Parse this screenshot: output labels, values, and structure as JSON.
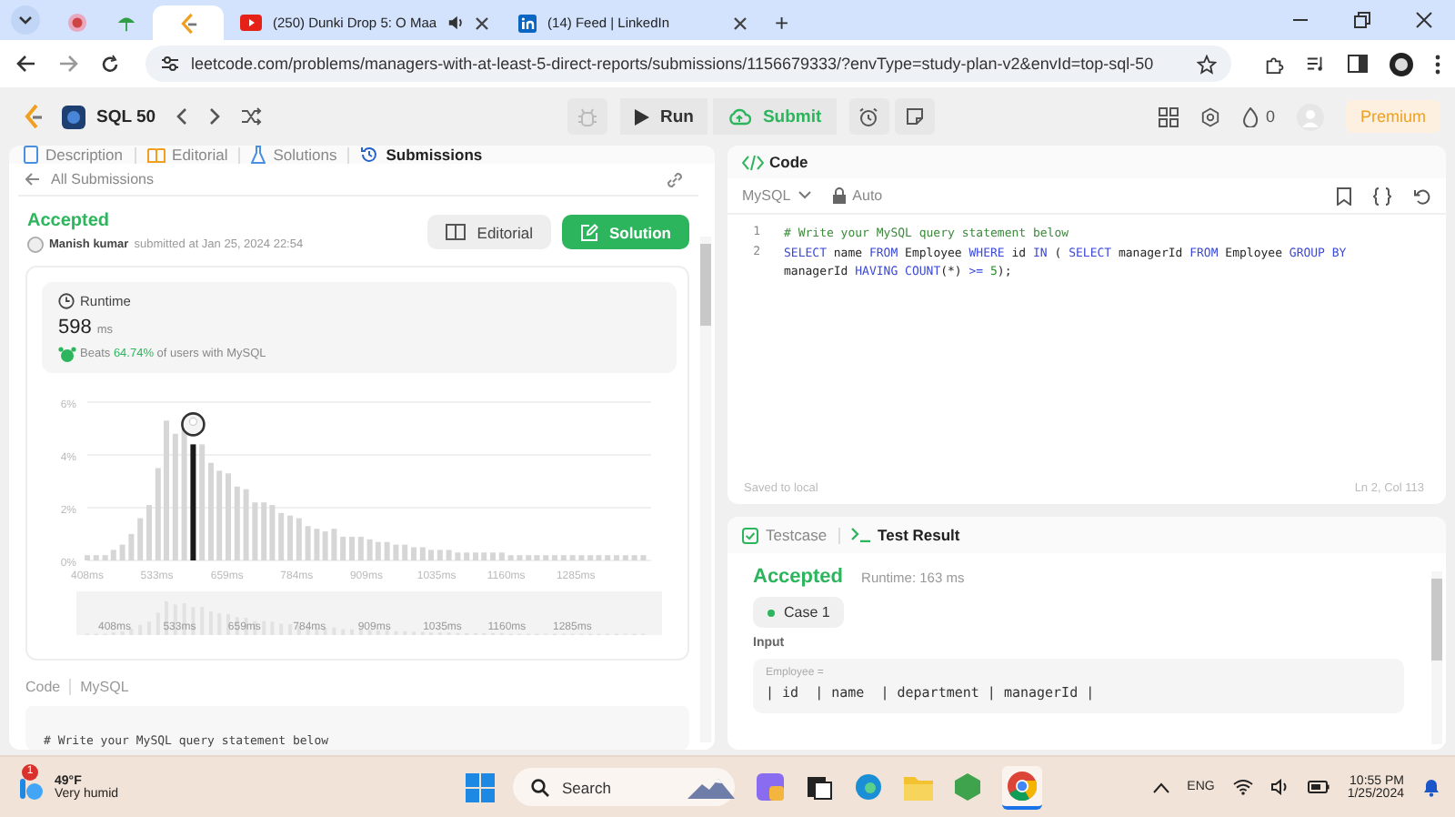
{
  "browser": {
    "tabs": [
      {
        "selected": false
      },
      {
        "selected": false
      },
      {
        "selected": true
      },
      {
        "title": "(250) Dunki Drop 5: O Maa",
        "selected": false
      },
      {
        "title": "(14) Feed | LinkedIn",
        "selected": false
      }
    ],
    "new_tab": "+",
    "url": "leetcode.com/problems/managers-with-at-least-5-direct-reports/submissions/1156679333/?envType=study-plan-v2&envId=top-sql-50"
  },
  "topbar": {
    "study_plan": "SQL 50",
    "run": "Run",
    "submit": "Submit",
    "streak": "0",
    "premium": "Premium"
  },
  "left_tabs": [
    {
      "label": "Description",
      "selected": false
    },
    {
      "label": "Editorial",
      "selected": false
    },
    {
      "label": "Solutions",
      "selected": false
    },
    {
      "label": "Submissions",
      "selected": true
    }
  ],
  "back_link": "All Submissions",
  "submission": {
    "status": "Accepted",
    "author": "Manish kumar",
    "submitted": "submitted at Jan 25, 2024 22:54",
    "editorial_button": "Editorial",
    "solution_button": "Solution"
  },
  "runtime": {
    "title": "Runtime",
    "value": "598",
    "unit": "ms",
    "beats_prefix": "Beats",
    "beats_percent": "64.74%",
    "beats_suffix": "of users with MySQL",
    "chart_data": {
      "type": "bar",
      "x": [
        408,
        424,
        440,
        455,
        471,
        487,
        503,
        519,
        535,
        550,
        566,
        582,
        598,
        614,
        630,
        645,
        661,
        677,
        693,
        709,
        725,
        740,
        756,
        772,
        788,
        804,
        820,
        835,
        851,
        867,
        883,
        899,
        915,
        930,
        946,
        962,
        978,
        994,
        1010,
        1025,
        1041,
        1057,
        1073,
        1089,
        1105,
        1120,
        1136,
        1152,
        1168,
        1184,
        1200,
        1215,
        1231,
        1247,
        1263,
        1279,
        1295,
        1311,
        1326,
        1342,
        1358,
        1374,
        1390,
        1406
      ],
      "values": [
        0.2,
        0.2,
        0.2,
        0.4,
        0.6,
        1.0,
        1.6,
        2.1,
        3.5,
        5.3,
        4.8,
        5.0,
        4.4,
        4.4,
        3.7,
        3.4,
        3.3,
        2.8,
        2.7,
        2.2,
        2.2,
        2.1,
        1.8,
        1.7,
        1.6,
        1.3,
        1.2,
        1.1,
        1.2,
        0.9,
        0.9,
        0.9,
        0.8,
        0.7,
        0.7,
        0.6,
        0.6,
        0.5,
        0.5,
        0.4,
        0.4,
        0.4,
        0.3,
        0.3,
        0.3,
        0.3,
        0.3,
        0.3,
        0.2,
        0.2,
        0.2,
        0.2,
        0.2,
        0.2,
        0.2,
        0.2,
        0.2,
        0.2,
        0.2,
        0.2,
        0.2,
        0.2,
        0.2,
        0.2
      ],
      "xlim": [
        408,
        1420
      ],
      "ylim": [
        0,
        6
      ],
      "xticks": [
        {
          "value": 408,
          "label": "408ms"
        },
        {
          "value": 533,
          "label": "533ms"
        },
        {
          "value": 659,
          "label": "659ms"
        },
        {
          "value": 784,
          "label": "784ms"
        },
        {
          "value": 909,
          "label": "909ms"
        },
        {
          "value": 1035,
          "label": "1035ms"
        },
        {
          "value": 1160,
          "label": "1160ms"
        },
        {
          "value": 1285,
          "label": "1285ms"
        }
      ],
      "yticks": [
        {
          "value": 0,
          "label": "0%"
        },
        {
          "value": 2,
          "label": "2%"
        },
        {
          "value": 4,
          "label": "4%"
        },
        {
          "value": 6,
          "label": "6%"
        }
      ]
    },
    "overview_labels": [
      "408ms",
      "533ms",
      "659ms",
      "784ms",
      "909ms",
      "1035ms",
      "1160ms",
      "1285ms"
    ]
  },
  "code_preview": {
    "label": "Code",
    "language": "MySQL",
    "first_line": "# Write your MySQL query statement below"
  },
  "editor": {
    "title": "Code",
    "language": "MySQL",
    "mode": "Auto",
    "lines": [
      {
        "number": "1",
        "tokens": [
          {
            "kind": "comment",
            "text": "# Write your MySQL query statement below"
          }
        ]
      },
      {
        "number": "2",
        "tokens": [
          {
            "kind": "keyword",
            "text": "SELECT"
          },
          {
            "kind": "plain",
            "text": " name "
          },
          {
            "kind": "keyword",
            "text": "FROM"
          },
          {
            "kind": "plain",
            "text": " Employee "
          },
          {
            "kind": "keyword",
            "text": "WHERE"
          },
          {
            "kind": "plain",
            "text": " id "
          },
          {
            "kind": "keyword",
            "text": "IN"
          },
          {
            "kind": "plain",
            "text": " ( "
          },
          {
            "kind": "keyword",
            "text": "SELECT"
          },
          {
            "kind": "plain",
            "text": " managerId "
          },
          {
            "kind": "keyword",
            "text": "FROM"
          },
          {
            "kind": "plain",
            "text": " Employee "
          },
          {
            "kind": "keyword",
            "text": "GROUP BY"
          },
          {
            "kind": "plain",
            "text": " managerId "
          },
          {
            "kind": "keyword",
            "text": "HAVING"
          },
          {
            "kind": "keyword",
            "text": " COUNT"
          },
          {
            "kind": "plain",
            "text": "(*) "
          },
          {
            "kind": "keyword",
            "text": ">="
          },
          {
            "kind": "number",
            "text": " 5"
          },
          {
            "kind": "plain",
            "text": ");"
          }
        ]
      }
    ],
    "saved": "Saved to local",
    "cursor": "Ln 2, Col 113"
  },
  "result_tabs": [
    {
      "label": "Testcase",
      "selected": false
    },
    {
      "label": "Test Result",
      "selected": true
    }
  ],
  "result": {
    "status": "Accepted",
    "runtime": "Runtime: 163 ms",
    "case": "Case 1",
    "input_label": "Input",
    "table_name": "Employee =",
    "table_header": "| id  | name  | department | managerId |"
  },
  "taskbar": {
    "temperature": "49°F",
    "weather": "Very humid",
    "badge": "1",
    "search": "Search",
    "language": "ENG",
    "time": "10:55 PM",
    "date": "1/25/2024"
  }
}
